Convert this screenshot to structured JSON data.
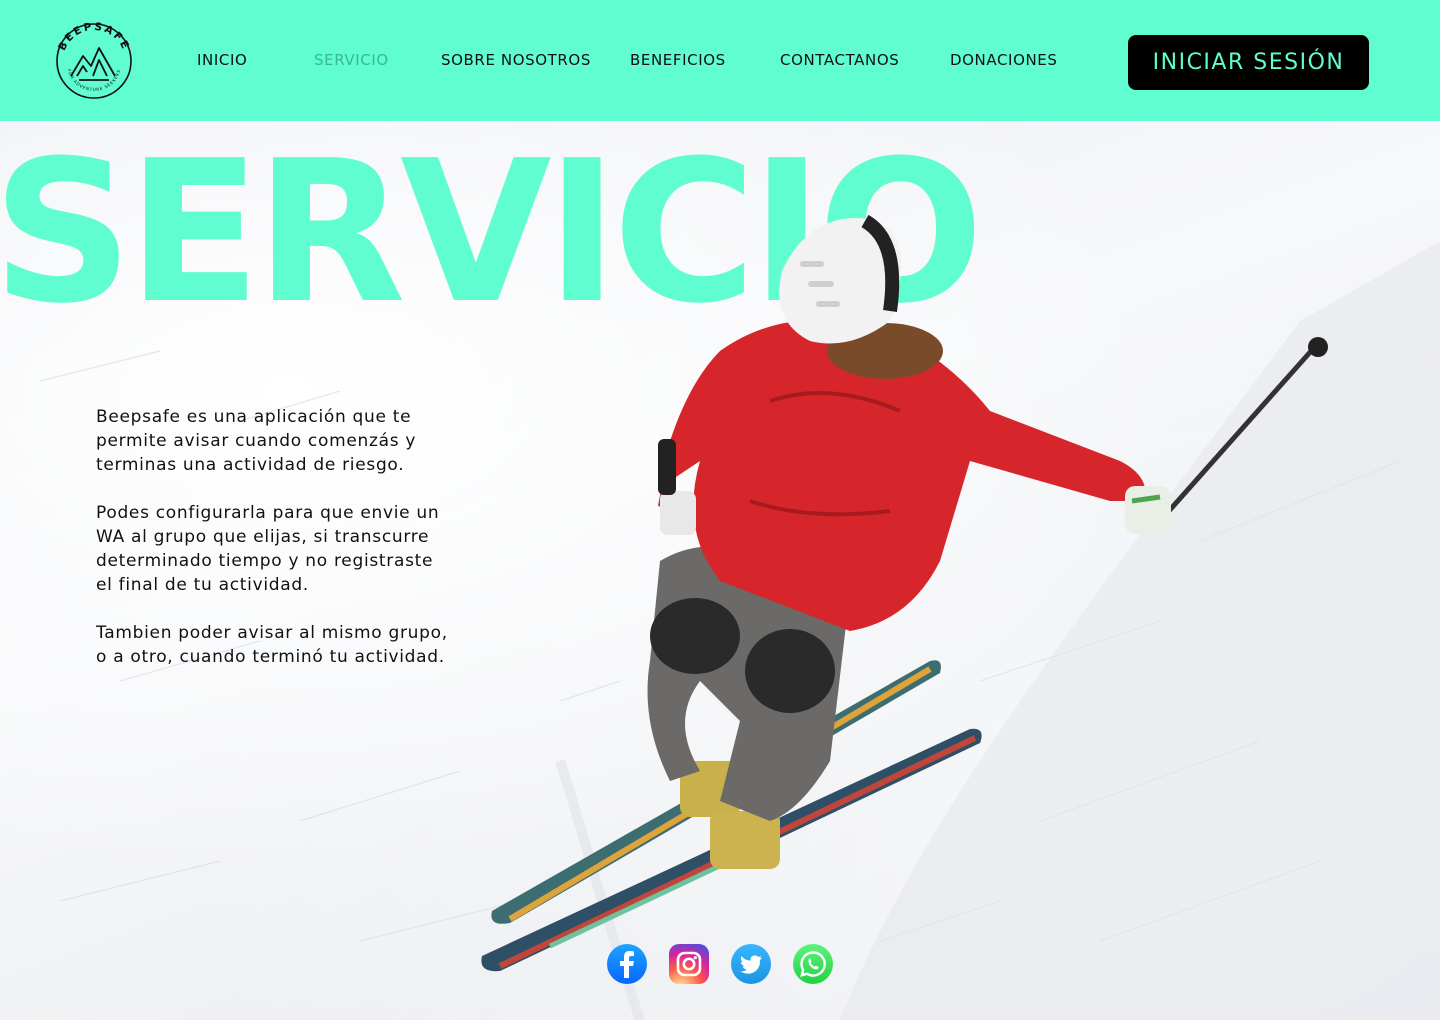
{
  "brand": {
    "name": "BEEPSAFE",
    "tagline": "FOR ADVENTURE SEEKERS",
    "accent_color": "#5ffdcf"
  },
  "nav": {
    "items": [
      {
        "label": "INICIO",
        "active": false
      },
      {
        "label": "SERVICIO",
        "active": true
      },
      {
        "label": "SOBRE NOSOTROS",
        "active": false
      },
      {
        "label": "BENEFICIOS",
        "active": false
      },
      {
        "label": "CONTACTANOS",
        "active": false
      },
      {
        "label": "DONACIONES",
        "active": false
      }
    ],
    "login_label": "INICIAR SESIÓN"
  },
  "hero": {
    "title": "SERVICIO",
    "paragraphs": [
      "Beepsafe es una aplicación que te\npermite avisar cuando comenzás y\nterminas una actividad de riesgo.",
      "Podes configurarla para que envie un\nWA al grupo que elijas, si transcurre\ndeterminado tiempo y no registraste\nel final de tu actividad.",
      "Tambien poder avisar al mismo grupo,\no a otro, cuando terminó tu actividad."
    ]
  },
  "socials": [
    {
      "name": "facebook-icon"
    },
    {
      "name": "instagram-icon"
    },
    {
      "name": "twitter-icon"
    },
    {
      "name": "whatsapp-icon"
    }
  ]
}
